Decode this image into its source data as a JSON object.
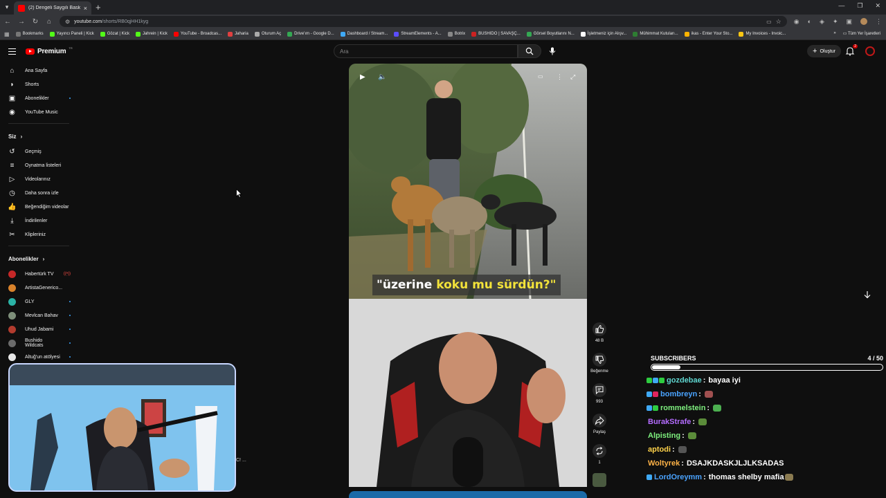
{
  "browser": {
    "tab_title": "(2) Dengeli Saygılı Baskın #köpek",
    "url_host": "youtube.com",
    "url_path": "/shorts/RB0qjHH1kyg",
    "bookmarks": [
      {
        "label": "Bookmarks",
        "color": "#777777"
      },
      {
        "label": "Yayıncı Paneli | Kick",
        "color": "#53fc18"
      },
      {
        "label": "Gözat | Kick",
        "color": "#53fc18"
      },
      {
        "label": "Jahrein | Kick",
        "color": "#53fc18"
      },
      {
        "label": "YouTube - Broadcas...",
        "color": "#ff0000"
      },
      {
        "label": "Jaharia",
        "color": "#e04040"
      },
      {
        "label": "Oturum Aç",
        "color": "#aaaaaa"
      },
      {
        "label": "Drive'ım - Google D...",
        "color": "#34a853"
      },
      {
        "label": "Dashboard / Stream...",
        "color": "#3fa9f5"
      },
      {
        "label": "StreamElements - A...",
        "color": "#5b4dff"
      },
      {
        "label": "Botrix",
        "color": "#888888"
      },
      {
        "label": "BUSHIDO | SAVAŞÇ...",
        "color": "#cc2222"
      },
      {
        "label": "Görsel Boyutlarını N...",
        "color": "#34a853"
      },
      {
        "label": "İşletmeniz için Alışv...",
        "color": "#ffffff"
      },
      {
        "label": "Mühimmat Kutuları...",
        "color": "#2e7d32"
      },
      {
        "label": "ikas - Enter Your Sto...",
        "color": "#ffb300"
      },
      {
        "label": "My Invoices - Invoic...",
        "color": "#f9c513"
      }
    ],
    "all_bookmarks": "Tüm Yer İşaretleri"
  },
  "header": {
    "logo_text": "Premium",
    "logo_tr": "TR",
    "search_placeholder": "Ara",
    "create_label": "Oluştur",
    "notif_count": "2"
  },
  "sidebar": {
    "main": [
      {
        "label": "Ana Sayfa",
        "icon": "home-icon"
      },
      {
        "label": "Shorts",
        "icon": "shorts-icon"
      },
      {
        "label": "Abonelikler",
        "icon": "subscriptions-icon"
      },
      {
        "label": "YouTube Music",
        "icon": "music-icon"
      }
    ],
    "you_heading": "Siz",
    "you": [
      {
        "label": "Geçmiş",
        "icon": "history-icon"
      },
      {
        "label": "Oynatma listeleri",
        "icon": "playlist-icon"
      },
      {
        "label": "Videolarınız",
        "icon": "your-videos-icon"
      },
      {
        "label": "Daha sonra izle",
        "icon": "watch-later-icon"
      },
      {
        "label": "Beğendiğim videolar",
        "icon": "liked-icon"
      },
      {
        "label": "İndirilenler",
        "icon": "download-icon"
      },
      {
        "label": "Klipleriniz",
        "icon": "clips-icon"
      }
    ],
    "subs_heading": "Abonelikler",
    "subs": [
      {
        "label": "Habertürk TV",
        "color": "#c62828",
        "live": true
      },
      {
        "label": "ArtistaGenerico...",
        "color": "#d9822b",
        "live": false
      },
      {
        "label": "GLY",
        "color": "#2bb3a6",
        "live": false
      },
      {
        "label": "Mevlcan Bahav",
        "color": "#7e8f7a",
        "live": false
      },
      {
        "label": "Uhud Jabami",
        "color": "#b23b2e",
        "live": false
      },
      {
        "label": "Bushido Wildcats",
        "color": "#6b6b6b",
        "live": false
      },
      {
        "label": "Altuğ'un atölyesi",
        "color": "#e8e8e8",
        "live": false
      }
    ],
    "live_mark": "((•))"
  },
  "short": {
    "caption_plain": "\"üzerine",
    "caption_highlight": "koku mu sürdün?\"",
    "actions": [
      {
        "name": "like-button",
        "icon": "thumbs-up-icon",
        "label": "48 B"
      },
      {
        "name": "dislike-button",
        "icon": "thumbs-down-icon",
        "label": "Beğenme"
      },
      {
        "name": "comments-button",
        "icon": "comment-icon",
        "label": "993"
      },
      {
        "name": "share-button",
        "icon": "share-icon",
        "label": "Paylaş"
      },
      {
        "name": "remix-button",
        "icon": "remix-icon",
        "label": "1"
      }
    ]
  },
  "webcam_tail": "C! ...",
  "overlay": {
    "subs_label": "SUBSCRIBERS",
    "subs_count": "4 / 50",
    "subs_progress": 0.08,
    "chat": [
      {
        "badges": [
          "#2ecc40",
          "#3fa9f5",
          "#2ecc40"
        ],
        "name": "gozdebae",
        "color": "#5fd6d0",
        "text": "bayaa iyi",
        "emotes": []
      },
      {
        "badges": [
          "#3fa9f5",
          "#e0245e"
        ],
        "name": "bombreyn",
        "color": "#4aa3ff",
        "text": "",
        "emotes": [
          "#a05050"
        ]
      },
      {
        "badges": [
          "#3fa9f5",
          "#2ecc40"
        ],
        "name": "rommelstein",
        "color": "#7ef07e",
        "text": "",
        "emotes": [
          "#4caf50"
        ]
      },
      {
        "badges": [],
        "name": "BurakStrafe",
        "color": "#b46cff",
        "text": "",
        "emotes": [
          "#5b8c3a"
        ]
      },
      {
        "badges": [],
        "name": "Alpisting",
        "color": "#7ef07e",
        "text": "",
        "emotes": [
          "#5b8c3a"
        ]
      },
      {
        "badges": [],
        "name": "aptodi",
        "color": "#ffd24a",
        "text": "",
        "emotes": [
          "#555555"
        ]
      },
      {
        "badges": [],
        "name": "Woltyrek",
        "color": "#ffb347",
        "text": "DSAJKDASKJLJLKSADAS",
        "emotes": []
      },
      {
        "badges": [
          "#3fa9f5"
        ],
        "name": "LordOreymm",
        "color": "#4aa3ff",
        "text": "thomas shelby mafia",
        "emotes": [
          "#8a7a50"
        ]
      }
    ]
  }
}
